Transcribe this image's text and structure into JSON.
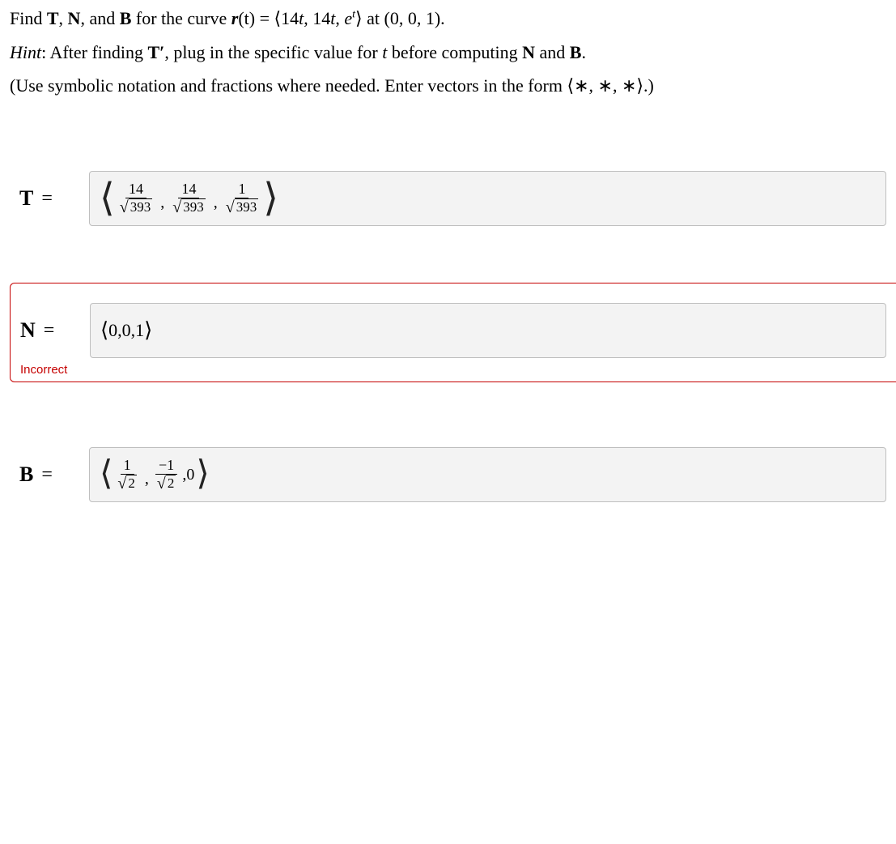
{
  "question": {
    "line1_pre": "Find ",
    "T": "T",
    "comma1": ", ",
    "N": "N",
    "and": ", and ",
    "B": "B",
    "line1_mid": " for the curve ",
    "r": "r",
    "of_t": "(t) = ",
    "vec_open": "⟨",
    "vec_body": "14t, 14t, e",
    "vec_exp": "t",
    "vec_close": "⟩",
    "line1_end": " at (0, 0, 1).",
    "hint_label": "Hint",
    "hint_body_a": ": After finding ",
    "Tprime": "T′",
    "hint_body_b": ", plug in the specific value for ",
    "hint_t": "t",
    "hint_body_c": " before computing ",
    "hint_N": "N",
    "hint_and": " and ",
    "hint_B": "B",
    "hint_end": ".",
    "line3": "(Use symbolic notation and fractions where needed. Enter vectors in the form ⟨∗, ∗, ∗⟩.)"
  },
  "answers": {
    "T": {
      "label": "T",
      "eq": "=",
      "f1num": "14",
      "f1rad": "393",
      "f2num": "14",
      "f2rad": "393",
      "f3num": "1",
      "f3rad": "393"
    },
    "N": {
      "label": "N",
      "eq": "=",
      "value": "0,0,1"
    },
    "B": {
      "label": "B",
      "eq": "=",
      "f1num": "1",
      "f1rad": "2",
      "f2num": "−1",
      "f2rad": "2",
      "last": ",0"
    }
  },
  "feedback": {
    "incorrect": "Incorrect"
  }
}
